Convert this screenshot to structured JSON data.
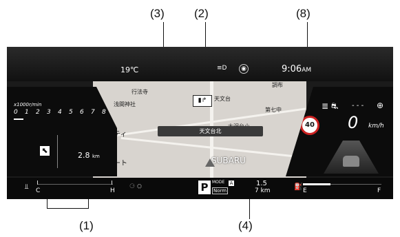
{
  "callouts": {
    "c1": "(1)",
    "c2": "(2)",
    "c3": "(3)",
    "c4": "(4)",
    "c8": "(8)"
  },
  "top": {
    "temp": "19℃",
    "clock": "9:06",
    "ampm": "AM"
  },
  "guide": {
    "place": "天文台北"
  },
  "tach": {
    "unit": "x1000r/min",
    "scale": [
      "0",
      "1",
      "2",
      "3",
      "4",
      "5",
      "6",
      "7",
      "8"
    ]
  },
  "nav": {
    "distance": "2.8",
    "dist_unit": "km"
  },
  "map": {
    "labels": [
      "行法寺",
      "浅間神社",
      "天文台",
      "第七中",
      "大沢台小",
      "SUBARU",
      "メシティ",
      "ート",
      "調布"
    ]
  },
  "speed": {
    "limit": "40",
    "value": "0",
    "unit": "km/h",
    "acc": "- - -"
  },
  "gear": {
    "value": "P",
    "mode_label": "MODE",
    "mode": "Norm"
  },
  "range": {
    "value": "1.5",
    "unit": "7 km"
  },
  "temp_gauge": {
    "low": "C",
    "high": "H"
  },
  "fuel_gauge": {
    "low": "E",
    "high": "F"
  }
}
